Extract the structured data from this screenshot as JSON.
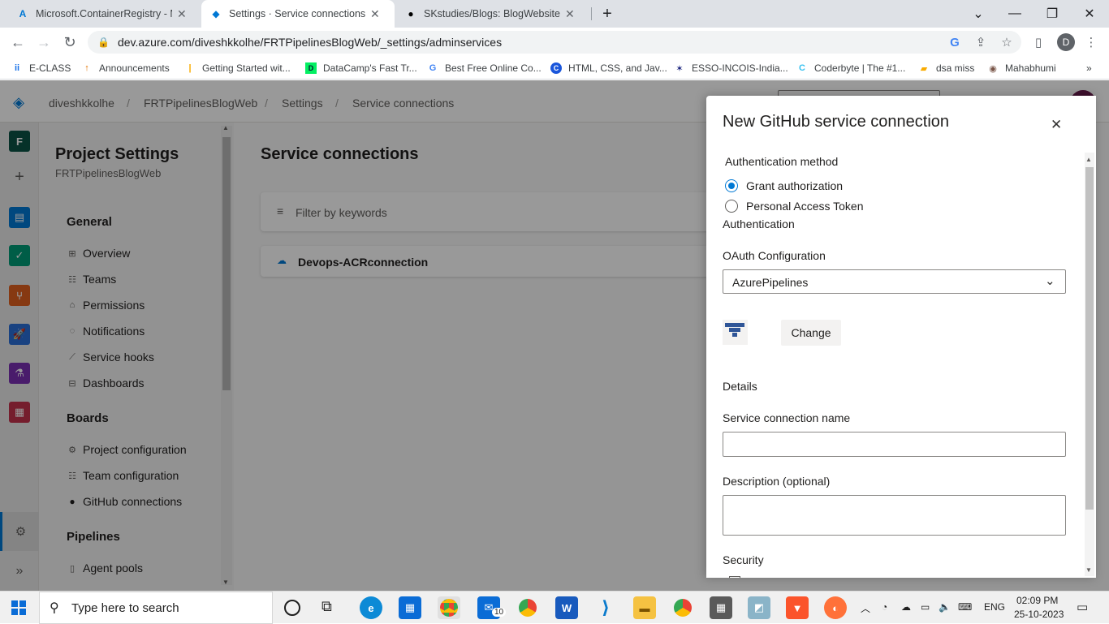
{
  "browser": {
    "tabs": [
      {
        "title": "Microsoft.ContainerRegistry - M",
        "icon": "azure-icon"
      },
      {
        "title": "Settings · Service connections (F",
        "icon": "devops-icon",
        "active": true
      },
      {
        "title": "SKstudies/Blogs: BlogWebsitePr",
        "icon": "github-icon"
      }
    ],
    "new_tab": "+",
    "url": "dev.azure.com/diveshkkolhe/FRTPipelinesBlogWeb/_settings/adminservices",
    "profile_initial": "D",
    "bookmarks": [
      {
        "label": "E-CLASS",
        "icon": "iirs-icon"
      },
      {
        "label": "Announcements",
        "icon": "pin-icon"
      },
      {
        "label": "Getting Started wit...",
        "icon": "doc-icon"
      },
      {
        "label": "DataCamp's Fast Tr...",
        "icon": "datacamp-icon"
      },
      {
        "label": "Best Free Online Co...",
        "icon": "google-icon"
      },
      {
        "label": "HTML, CSS, and Jav...",
        "icon": "course-icon"
      },
      {
        "label": "ESSO-INCOIS-India...",
        "icon": "incois-icon"
      },
      {
        "label": "Coderbyte | The #1...",
        "icon": "coderbyte-icon"
      },
      {
        "label": "dsa miss",
        "icon": "folder-icon"
      },
      {
        "label": "Mahabhumi",
        "icon": "mahabhumi-icon"
      }
    ]
  },
  "ado": {
    "breadcrumb": [
      "diveshkkolhe",
      "FRTPipelinesBlogWeb",
      "Settings",
      "Service connections"
    ],
    "rail_project_initial": "F",
    "settings": {
      "title": "Project Settings",
      "subtitle": "FRTPipelinesBlogWeb",
      "sections": [
        {
          "heading": "General",
          "items": [
            "Overview",
            "Teams",
            "Permissions",
            "Notifications",
            "Service hooks",
            "Dashboards"
          ]
        },
        {
          "heading": "Boards",
          "items": [
            "Project configuration",
            "Team configuration",
            "GitHub connections"
          ]
        },
        {
          "heading": "Pipelines",
          "items": [
            "Agent pools"
          ]
        }
      ]
    },
    "main": {
      "title": "Service connections",
      "filter_placeholder": "Filter by keywords",
      "connections": [
        "Devops-ACRconnection"
      ]
    }
  },
  "panel": {
    "title": "New GitHub service connection",
    "auth_method_label": "Authentication method",
    "options": [
      {
        "label": "Grant authorization",
        "selected": true
      },
      {
        "label": "Personal Access Token",
        "selected": false
      }
    ],
    "authentication_label": "Authentication",
    "oauth_label": "OAuth Configuration",
    "oauth_value": "AzurePipelines",
    "change_button": "Change",
    "details_label": "Details",
    "name_label": "Service connection name",
    "name_value": "",
    "description_label": "Description (optional)",
    "description_value": "",
    "security_label": "Security"
  },
  "taskbar": {
    "search_placeholder": "Type here to search",
    "language": "ENG",
    "time": "02:09 PM",
    "date": "25-10-2023",
    "mail_badge": "10"
  },
  "colors": {
    "accent": "#0078d4",
    "overlay": "rgba(0,0,0,0.4)"
  }
}
